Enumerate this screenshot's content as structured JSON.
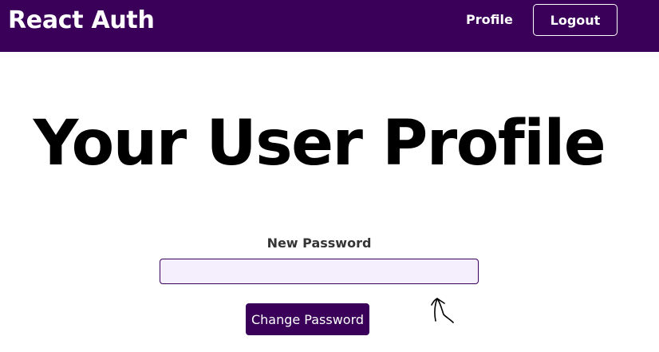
{
  "header": {
    "logo_text": "React Auth",
    "nav": {
      "profile_label": "Profile",
      "logout_label": "Logout"
    },
    "background_color": "#3a0059"
  },
  "main": {
    "title": "Your User Profile",
    "form": {
      "password_label": "New Password",
      "password_value": "",
      "submit_label": "Change Password"
    }
  },
  "colors": {
    "accent": "#3a0059",
    "input_background": "#f5eefc",
    "input_border": "#38015c"
  }
}
